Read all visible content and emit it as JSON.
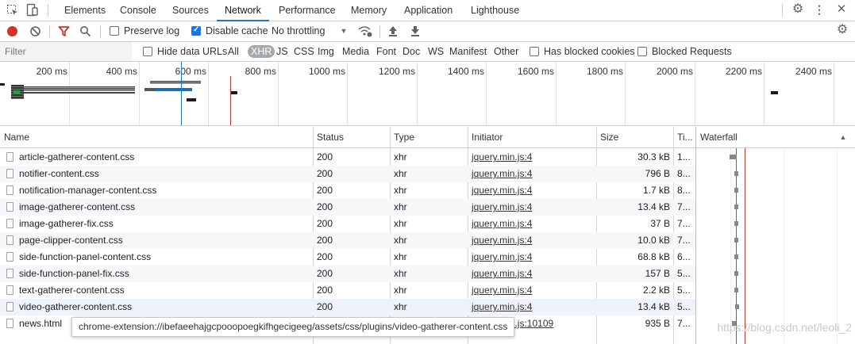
{
  "tabs": [
    "Elements",
    "Console",
    "Sources",
    "Network",
    "Performance",
    "Memory",
    "Application",
    "Lighthouse"
  ],
  "active_tab": "Network",
  "toolbar": {
    "preserve_log": "Preserve log",
    "disable_cache": "Disable cache",
    "throttling": "No throttling"
  },
  "filter": {
    "placeholder": "Filter",
    "hide_data_urls": "Hide data URLs",
    "types": [
      "All",
      "XHR",
      "JS",
      "CSS",
      "Img",
      "Media",
      "Font",
      "Doc",
      "WS",
      "Manifest",
      "Other"
    ],
    "selected_type": "XHR",
    "has_blocked_cookies": "Has blocked cookies",
    "blocked_requests": "Blocked Requests"
  },
  "overview": {
    "ticks": [
      "200 ms",
      "400 ms",
      "600 ms",
      "800 ms",
      "1000 ms",
      "1200 ms",
      "1400 ms",
      "1600 ms",
      "1800 ms",
      "2000 ms",
      "2200 ms",
      "2400 ms"
    ]
  },
  "columns": {
    "name": "Name",
    "status": "Status",
    "type": "Type",
    "initiator": "Initiator",
    "size": "Size",
    "time": "Ti...",
    "waterfall": "Waterfall"
  },
  "rows": [
    {
      "name": "article-gatherer-content.css",
      "status": "200",
      "type": "xhr",
      "initiator": "jquery.min.js:4",
      "size": "30.3 kB",
      "time": "1..."
    },
    {
      "name": "notifier-content.css",
      "status": "200",
      "type": "xhr",
      "initiator": "jquery.min.js:4",
      "size": "796 B",
      "time": "8..."
    },
    {
      "name": "notification-manager-content.css",
      "status": "200",
      "type": "xhr",
      "initiator": "jquery.min.js:4",
      "size": "1.7 kB",
      "time": "8..."
    },
    {
      "name": "image-gatherer-content.css",
      "status": "200",
      "type": "xhr",
      "initiator": "jquery.min.js:4",
      "size": "13.4 kB",
      "time": "7..."
    },
    {
      "name": "image-gatherer-fix.css",
      "status": "200",
      "type": "xhr",
      "initiator": "jquery.min.js:4",
      "size": "37 B",
      "time": "7..."
    },
    {
      "name": "page-clipper-content.css",
      "status": "200",
      "type": "xhr",
      "initiator": "jquery.min.js:4",
      "size": "10.0 kB",
      "time": "7..."
    },
    {
      "name": "side-function-panel-content.css",
      "status": "200",
      "type": "xhr",
      "initiator": "jquery.min.js:4",
      "size": "68.8 kB",
      "time": "6..."
    },
    {
      "name": "side-function-panel-fix.css",
      "status": "200",
      "type": "xhr",
      "initiator": "jquery.min.js:4",
      "size": "157 B",
      "time": "5..."
    },
    {
      "name": "text-gatherer-content.css",
      "status": "200",
      "type": "xhr",
      "initiator": "jquery.min.js:4",
      "size": "2.2 kB",
      "time": "5..."
    },
    {
      "name": "video-gatherer-content.css",
      "status": "200",
      "type": "xhr",
      "initiator": "jquery.min.js:4",
      "size": "13.4 kB",
      "time": "5..."
    },
    {
      "name": "news.html",
      "status": "200",
      "type": "xhr",
      "initiator": "jquery.min.js:10109",
      "size": "935 B",
      "time": "7..."
    }
  ],
  "tooltip": "chrome-extension://ibefaeehajgcpooopoegkifhgecigeeg/assets/css/plugins/video-gatherer-content.css",
  "watermark": "https://blog.csdn.net/leoli_2",
  "colors": {
    "accent": "#1a73e8",
    "record": "#d93025",
    "filter_icon": "#d93025",
    "dom_content_loaded": "#1a73e8",
    "load": "#d93025"
  }
}
